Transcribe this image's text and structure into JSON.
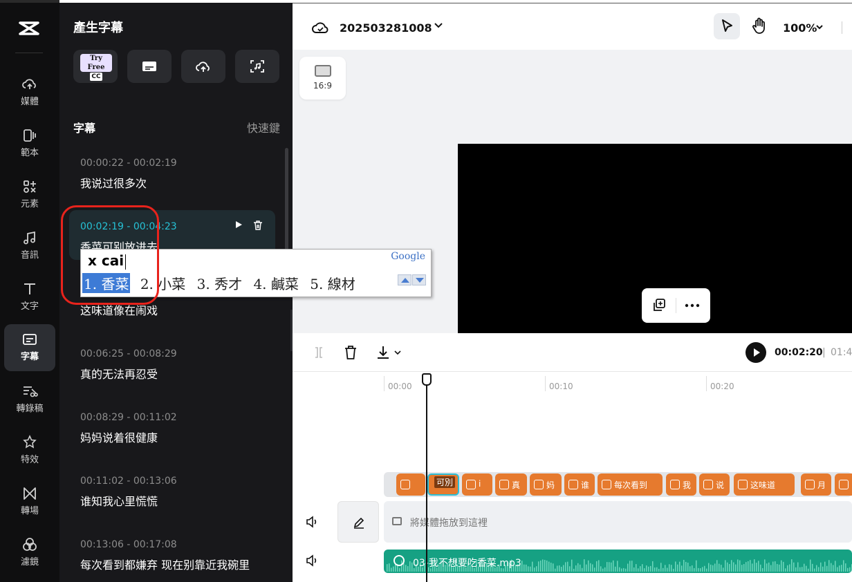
{
  "rail": {
    "logo": "⌘",
    "items": [
      {
        "label": "媒體",
        "icon": "cloud-upload-icon"
      },
      {
        "label": "範本",
        "icon": "template-icon"
      },
      {
        "label": "元素",
        "icon": "elements-icon"
      },
      {
        "label": "音訊",
        "icon": "music-icon"
      },
      {
        "label": "文字",
        "icon": "text-icon"
      },
      {
        "label": "字幕",
        "icon": "subtitle-icon",
        "active": true
      },
      {
        "label": "轉錄稿",
        "icon": "transcript-icon"
      },
      {
        "label": "特效",
        "icon": "effects-icon"
      },
      {
        "label": "轉場",
        "icon": "transition-icon"
      },
      {
        "label": "濾鏡",
        "icon": "filter-icon"
      }
    ]
  },
  "panel": {
    "title": "產生字幕",
    "try_free": "Try Free",
    "cc": "CC",
    "section_title": "字幕",
    "shortcut_link": "快速鍵",
    "subtitles": [
      {
        "time": "00:00:22 - 00:02:19",
        "text": "我说过很多次"
      },
      {
        "time": "00:02:19 - 00:04:23",
        "text": "香菜可别放进去",
        "active": true
      },
      {
        "time": "",
        "text": "这味道像在闹戏"
      },
      {
        "time": "00:06:25 - 00:08:29",
        "text": "真的无法再忍受"
      },
      {
        "time": "00:08:29 - 00:11:02",
        "text": "妈妈说着很健康"
      },
      {
        "time": "00:11:02 - 00:13:06",
        "text": "谁知我心里慌慌"
      },
      {
        "time": "00:13:06 - 00:17:08",
        "text": "每次看到都嫌弃 现在别靠近我碗里"
      }
    ]
  },
  "topbar": {
    "project_name": "202503281008",
    "zoom": "100%"
  },
  "canvas": {
    "ratio_label": "16:9"
  },
  "timeline": {
    "current_time": "00:02:20",
    "separator": "|",
    "total_time": "01:4",
    "ruler": [
      "00:00",
      "00:10",
      "00:20"
    ],
    "clips": [
      {
        "text": "",
        "sel": false
      },
      {
        "text": "可別",
        "sel": true
      },
      {
        "text": "i",
        "sel": false
      },
      {
        "text": "真",
        "sel": false
      },
      {
        "text": "妈",
        "sel": false
      },
      {
        "text": "谁",
        "sel": false
      },
      {
        "text": "每次看到",
        "sel": false
      },
      {
        "text": "我",
        "sel": false
      },
      {
        "text": "说",
        "sel": false
      },
      {
        "text": "这味道",
        "sel": false
      },
      {
        "text": "月",
        "sel": false
      },
      {
        "text": "",
        "sel": false
      }
    ],
    "media_placeholder": "將媒體拖放到這裡",
    "audio_name": "03-我不想要吃香菜.mp3"
  },
  "ime": {
    "input": "x cai",
    "brand": "Google",
    "candidates": [
      "1. 香菜",
      "2. 小菜",
      "3. 秀才",
      "4. 鹹菜",
      "5. 線材"
    ]
  },
  "colors": {
    "accent_cyan": "#26c2d6",
    "clip_orange": "#e67a2e",
    "audio_green": "#16a183",
    "annotation_red": "#e8231c"
  }
}
